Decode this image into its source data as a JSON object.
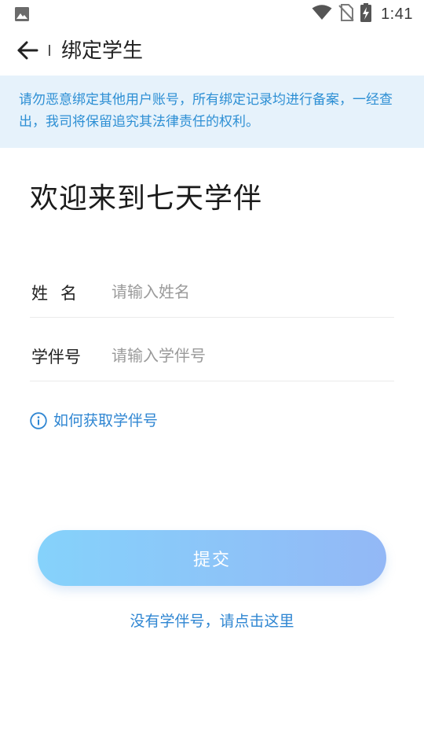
{
  "status_bar": {
    "time": "1:41",
    "icons": [
      "image-icon",
      "wifi-icon",
      "no-sim-icon",
      "battery-charging-icon"
    ]
  },
  "header": {
    "title": "绑定学生",
    "back_icon": "back-arrow-icon"
  },
  "notice": {
    "text": "请勿恶意绑定其他用户账号，所有绑定记录均进行备案，一经查出，我司将保留追究其法律责任的权利。"
  },
  "welcome": {
    "text": "欢迎来到七天学伴"
  },
  "form": {
    "name": {
      "label": "姓名",
      "value": "",
      "placeholder": "请输入姓名"
    },
    "student_id": {
      "label": "学伴号",
      "value": "",
      "placeholder": "请输入学伴号"
    }
  },
  "help": {
    "icon": "info-icon",
    "text": "如何获取学伴号"
  },
  "submit": {
    "label": "提交"
  },
  "footer_link": {
    "text": "没有学伴号，请点击这里"
  },
  "colors": {
    "accent": "#2f86d2",
    "notice_bg": "#e6f2fb",
    "notice_text": "#2d8fd4",
    "button_gradient_start": "#85d2fb",
    "button_gradient_end": "#93b8f6"
  }
}
